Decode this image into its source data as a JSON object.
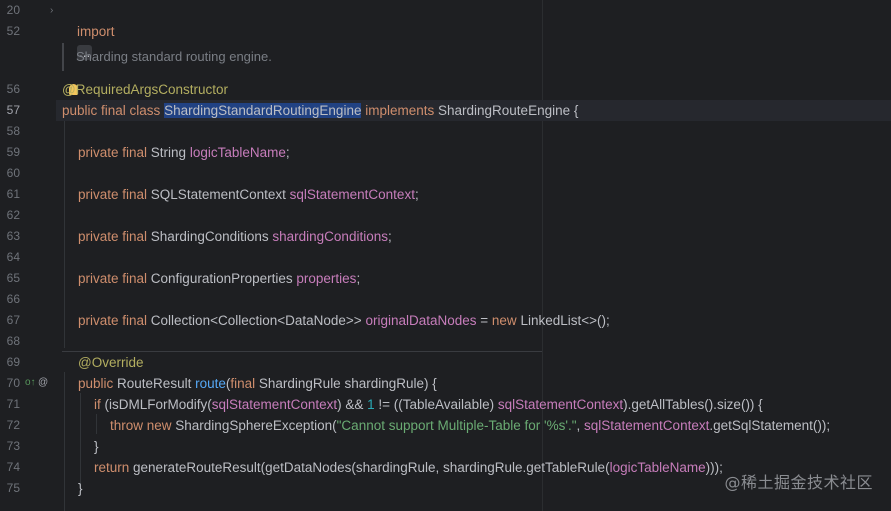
{
  "gutter": {
    "line_numbers": [
      "20",
      "52",
      "56",
      "57",
      "58",
      "59",
      "60",
      "61",
      "62",
      "63",
      "64",
      "65",
      "66",
      "67",
      "68",
      "69",
      "70",
      "71",
      "72",
      "73",
      "74",
      "75"
    ],
    "current_line": "57"
  },
  "doc_comment": "Sharding standard routing engine.",
  "code": {
    "l20_import": "import",
    "l20_dots": "...",
    "l56_at": "@",
    "l56_ann": "RequiredArgsConstructor",
    "l57_kw": "public final class ",
    "l57_cls": "ShardingStandardRoutingEngine",
    "l57_impl": " implements ",
    "l57_iface": "ShardingRouteEngine {",
    "l59_kw": "private final ",
    "l59_type": "String ",
    "l59_field": "logicTableName",
    "l59_end": ";",
    "l61_kw": "private final ",
    "l61_type": "SQLStatementContext ",
    "l61_field": "sqlStatementContext",
    "l61_end": ";",
    "l63_kw": "private final ",
    "l63_type": "ShardingConditions ",
    "l63_field": "shardingConditions",
    "l63_end": ";",
    "l65_kw": "private final ",
    "l65_type": "ConfigurationProperties ",
    "l65_field": "properties",
    "l65_end": ";",
    "l67_kw": "private final ",
    "l67_type": "Collection<Collection<DataNode>> ",
    "l67_field": "originalDataNodes",
    "l67_eq": " = ",
    "l67_new": "new ",
    "l67_rest": "LinkedList<>();",
    "l69_ann": "@Override",
    "l70_kw": "public ",
    "l70_type": "RouteResult ",
    "l70_fn": "route",
    "l70_p1": "(",
    "l70_final": "final ",
    "l70_rest": "ShardingRule shardingRule) {",
    "l71_if": "if ",
    "l71_a": "(isDMLForModify(",
    "l71_f1": "sqlStatementContext",
    "l71_b": ") && ",
    "l71_num": "1",
    "l71_c": " != ((TableAvailable) ",
    "l71_f2": "sqlStatementContext",
    "l71_d": ").getAllTables().size()) {",
    "l72_throw": "throw new ",
    "l72_a": "ShardingSphereException(",
    "l72_str": "\"Cannot support Multiple-Table for '%s'.\"",
    "l72_b": ", ",
    "l72_f": "sqlStatementContext",
    "l72_c": ".getSqlStatement());",
    "l73": "}",
    "l74_ret": "return ",
    "l74_a": "generateRouteResult(getDataNodes(shardingRule, shardingRule.getTableRule(",
    "l74_f": "logicTableName",
    "l74_b": ")));",
    "l75": "}"
  },
  "gutter_icons": {
    "override_marker": "o↑",
    "annotation_marker": "@"
  },
  "watermark": "@稀土掘金技术社区",
  "colors": {
    "background": "#1e1f22",
    "keyword": "#cf8e6d",
    "field": "#c77dbb",
    "function": "#56a8f5",
    "string": "#6aab73",
    "number": "#2aacb8",
    "annotation": "#b3ae60",
    "selection": "#214283"
  }
}
